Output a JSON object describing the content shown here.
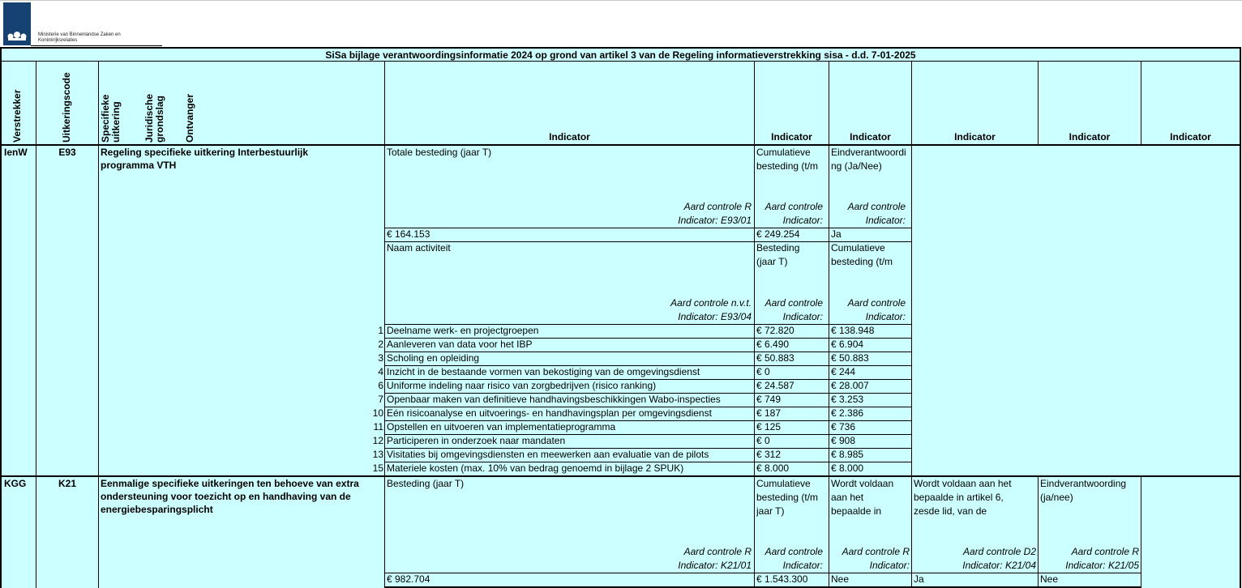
{
  "logo": {
    "name_line1": "Ministerie van Binnenlandse Zaken en",
    "name_line2": "Koninkrijksrelaties"
  },
  "title": "SiSa bijlage verantwoordingsinformatie 2024 op grond van artikel 3 van de Regeling informatieverstrekking sisa - d.d. 7-01-2025",
  "headers": {
    "verstrekker": "Verstrekker",
    "uitkeringscode": "Uitkeringscode",
    "specifieke_uitkering": [
      "Specifieke",
      "uitkering"
    ],
    "juridische_grondslag": [
      "Juridische",
      "grondslag"
    ],
    "ontvanger": "Ontvanger",
    "indicator": "Indicator"
  },
  "e93": {
    "verstrekker": "IenW",
    "code": "E93",
    "name": "Regeling specifieke uitkering Interbestuurlijk programma VTH",
    "block1": {
      "col1": "Totale besteding (jaar T)",
      "col2": [
        "Cumulatieve",
        "besteding (t/m"
      ],
      "col3": [
        "Eindverantwoordi",
        "ng (Ja/Nee)"
      ],
      "ctrl1": [
        "Aard controle R",
        "Indicator: E93/01"
      ],
      "ctrl2": [
        "Aard controle",
        "Indicator:"
      ],
      "ctrl3": [
        "Aard controle",
        "Indicator:"
      ],
      "val1": "€ 164.153",
      "val2": "€ 249.254",
      "val3": "Ja"
    },
    "block2": {
      "col1": "Naam activiteit",
      "col2": [
        "Besteding",
        "(jaar T)"
      ],
      "col3": [
        "Cumulatieve",
        "besteding (t/m"
      ],
      "ctrl1": [
        "Aard controle n.v.t.",
        "Indicator: E93/04"
      ],
      "ctrl2": [
        "Aard controle",
        "Indicator:"
      ],
      "ctrl3": [
        "Aard controle",
        "Indicator:"
      ]
    },
    "activities": [
      {
        "nr": "1",
        "name": "Deelname werk- en projectgroepen",
        "jaar": "€ 72.820",
        "cum": "€ 138.948"
      },
      {
        "nr": "2",
        "name": "Aanleveren van data voor het IBP",
        "jaar": "€ 6.490",
        "cum": "€ 6.904"
      },
      {
        "nr": "3",
        "name": "Scholing en opleiding",
        "jaar": "€ 50.883",
        "cum": "€ 50.883"
      },
      {
        "nr": "4",
        "name": "Inzicht in de bestaande vormen van bekostiging van de omgevingsdienst",
        "jaar": "€ 0",
        "cum": "€ 244"
      },
      {
        "nr": "6",
        "name": "Uniforme indeling naar risico van zorgbedrijven (risico ranking)",
        "jaar": "€ 24.587",
        "cum": "€ 28.007"
      },
      {
        "nr": "7",
        "name": "Openbaar maken van definitieve handhavingsbeschikkingen Wabo-inspecties",
        "jaar": "€ 749",
        "cum": "€ 3.253"
      },
      {
        "nr": "10",
        "name": "Eén risicoanalyse en uitvoerings- en handhavingsplan per omgevingsdienst",
        "jaar": "€ 187",
        "cum": "€ 2.386"
      },
      {
        "nr": "11",
        "name": "Opstellen en uitvoeren van implementatieprogramma",
        "jaar": "€ 125",
        "cum": "€ 736"
      },
      {
        "nr": "12",
        "name": "Participeren in onderzoek naar mandaten",
        "jaar": "€ 0",
        "cum": "€ 908"
      },
      {
        "nr": "13",
        "name": "Visitaties bij omgevingsdiensten en meewerken aan evaluatie van de pilots",
        "jaar": "€ 312",
        "cum": "€ 8.985"
      },
      {
        "nr": "15",
        "name": "Materiele kosten (max. 10% van bedrag genoemd in bijlage 2 SPUK)",
        "jaar": "€ 8.000",
        "cum": "€ 8.000"
      }
    ]
  },
  "k21": {
    "verstrekker": "KGG",
    "code": "K21",
    "name": "Eenmalige specifieke uitkeringen ten behoeve van extra ondersteuning voor toezicht op en handhaving van de energiebesparingsplicht",
    "col1": "Besteding (jaar T)",
    "col2": [
      "Cumulatieve",
      "besteding (t/m",
      "jaar T)"
    ],
    "col3": [
      "Wordt voldaan",
      "aan het",
      "bepaalde in"
    ],
    "col4": [
      "Wordt voldaan aan het",
      "bepaalde in artikel 6,",
      "zesde lid, van de"
    ],
    "col5": [
      "Eindverantwoording",
      "(ja/nee)"
    ],
    "ctrl1": [
      "Aard controle R",
      "Indicator: K21/01"
    ],
    "ctrl2": [
      "Aard controle",
      "Indicator:"
    ],
    "ctrl3": [
      "Aard controle R",
      "Indicator:"
    ],
    "ctrl4": [
      "Aard controle D2",
      "Indicator: K21/04"
    ],
    "ctrl5": [
      "Aard controle R",
      "Indicator: K21/05"
    ],
    "val1": "€ 982.704",
    "val2": "€ 1.543.300",
    "val3": "Nee",
    "val4": "Ja",
    "val5": "Nee"
  }
}
